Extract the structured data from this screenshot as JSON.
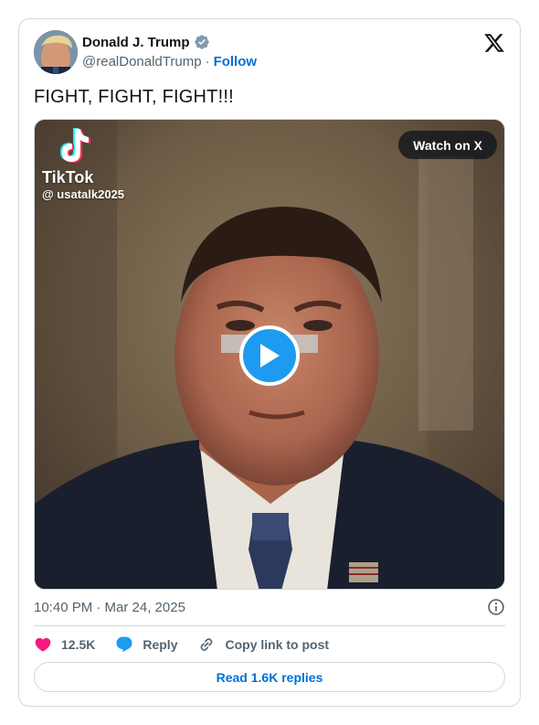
{
  "author": {
    "display_name": "Donald J. Trump",
    "handle": "@realDonaldTrump",
    "separator": "·",
    "follow_label": "Follow",
    "verified": true
  },
  "tweet": {
    "text": "FIGHT, FIGHT, FIGHT!!!"
  },
  "media": {
    "watermark_brand": "TikTok",
    "watermark_user": "@ usatalk2025",
    "watch_label": "Watch on X",
    "play_icon": "play-icon"
  },
  "meta": {
    "timestamp": "10:40 PM · Mar 24, 2025",
    "info_icon": "info-icon"
  },
  "actions": {
    "like_count": "12.5K",
    "reply_label": "Reply",
    "copy_link_label": "Copy link to post"
  },
  "replies_button_label": "Read 1.6K replies",
  "colors": {
    "link_blue": "#006fd6",
    "play_blue": "#1d9bf0",
    "like_pink": "#f91880",
    "reply_blue": "#1d9bf0",
    "verified_gray": "#829aab",
    "border": "#cfd9de",
    "muted_text": "#536471"
  }
}
